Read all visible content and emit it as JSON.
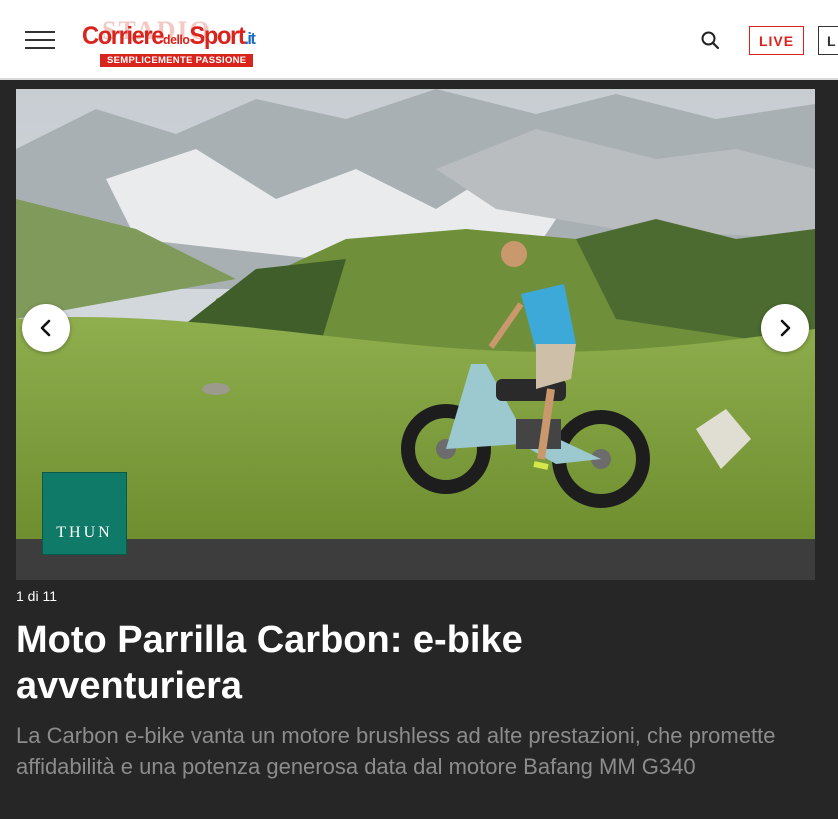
{
  "header": {
    "logo": {
      "watermark": "STADIO",
      "name_part1": "Corriere",
      "name_part2": "dello",
      "name_part3": "Sport",
      "name_part4": ".it",
      "tagline": "SEMPLICEMENTE PASSIONE"
    },
    "live_label": "LIVE",
    "cut_button_label": "L",
    "colors": {
      "brand": "#d8241c",
      "header_bg": "#ffffff"
    }
  },
  "gallery": {
    "counter": "1 di 11",
    "current": 1,
    "total": 11,
    "sponsor": "THUN",
    "title": "Moto Parrilla Carbon: e-bike avventuriera",
    "description": "La Carbon e-bike vanta un motore brushless ad alte prestazioni, che promette affidabilità e una potenza generosa data dal motore Bafang MM G340",
    "colors": {
      "page_bg": "#262626",
      "sponsor_bg": "#0f7a67"
    }
  },
  "icons": [
    "menu-icon",
    "search-icon",
    "chevron-left-icon",
    "chevron-right-icon"
  ]
}
